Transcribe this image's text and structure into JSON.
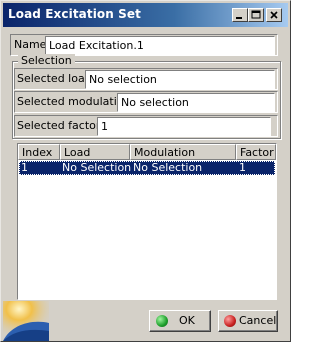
{
  "window": {
    "title": "Load Excitation Set"
  },
  "name_row": {
    "label": "Name",
    "value": "Load Excitation.1"
  },
  "selection": {
    "title": "Selection",
    "load": {
      "label": "Selected load:",
      "value": "No selection"
    },
    "modulation": {
      "label": "Selected modulation:",
      "value": "No selection"
    },
    "factor": {
      "label": "Selected factor:",
      "value": "1"
    }
  },
  "table": {
    "columns": [
      "Index",
      "Load",
      "Modulation",
      "Factor"
    ],
    "rows": [
      {
        "index": "1",
        "load": "No Selection",
        "modulation": "No Selection",
        "factor": "1"
      }
    ],
    "selected_row_color": "#0a246a"
  },
  "buttons": {
    "ok": "OK",
    "cancel": "Cancel"
  },
  "icons": {
    "minimize": "minimize-icon",
    "maximize": "maximize-icon",
    "close": "close-icon",
    "ok": "green-dot-icon",
    "cancel": "red-dot-icon",
    "logo": "catia-logo-icon"
  },
  "colors": {
    "dialog_bg": "#d4d0c8",
    "title_start": "#0a246a",
    "title_end": "#a6caf0",
    "ok": "#1d9e2a",
    "cancel": "#c8201f"
  }
}
